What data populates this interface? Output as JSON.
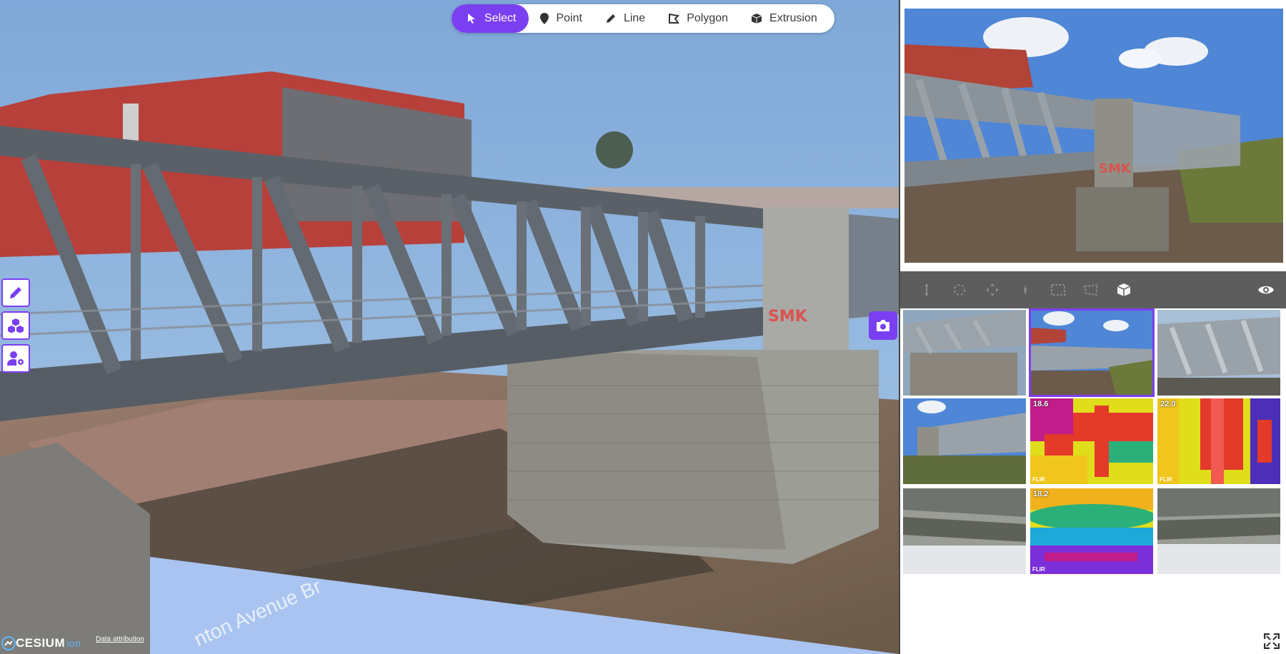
{
  "toolbar": {
    "items": [
      {
        "label": "Select",
        "icon": "cursor-icon",
        "active": true
      },
      {
        "label": "Point",
        "icon": "map-pin-icon",
        "active": false
      },
      {
        "label": "Line",
        "icon": "pencil-icon",
        "active": false
      },
      {
        "label": "Polygon",
        "icon": "polygon-icon",
        "active": false
      },
      {
        "label": "Extrusion",
        "icon": "cube-icon",
        "active": false
      }
    ]
  },
  "sidebar": {
    "buttons": [
      {
        "icon": "pencil-icon"
      },
      {
        "icon": "layers-cubes-icon"
      },
      {
        "icon": "user-settings-icon"
      }
    ]
  },
  "viewer": {
    "logo_main": "CESIUM",
    "logo_sub": "ion",
    "attribution": "Data attribution",
    "street_label": "nton Avenue Br",
    "accent_color": "#7b3ff2"
  },
  "photo_toolbar": {
    "tools": [
      "move-icon",
      "rotate-icon",
      "pan-icon",
      "point-icon",
      "rectangle-icon",
      "region-icon",
      "cube-icon"
    ],
    "eye_icon": "eye-icon"
  },
  "thumbnails": [
    {
      "kind": "photo",
      "temp": "",
      "selected": false
    },
    {
      "kind": "photo",
      "temp": "",
      "selected": true
    },
    {
      "kind": "photo",
      "temp": "",
      "selected": false
    },
    {
      "kind": "photo",
      "temp": "",
      "selected": false
    },
    {
      "kind": "thermal",
      "temp": "18.6",
      "selected": false
    },
    {
      "kind": "thermal",
      "temp": "22.0",
      "selected": false
    },
    {
      "kind": "photo",
      "temp": "",
      "selected": false
    },
    {
      "kind": "thermal",
      "temp": "18.2",
      "selected": false
    },
    {
      "kind": "photo",
      "temp": "",
      "selected": false
    }
  ],
  "flir_label": "FLIR"
}
